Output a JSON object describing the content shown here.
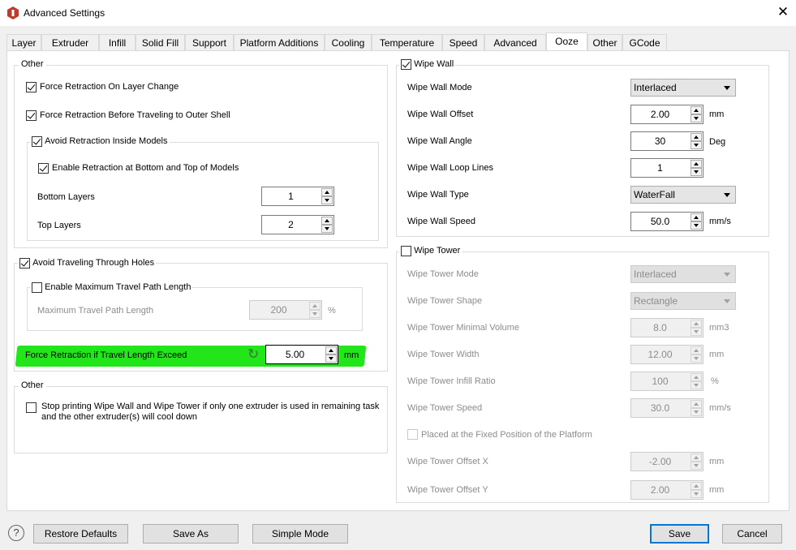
{
  "window": {
    "title": "Advanced Settings",
    "close_icon": "✕"
  },
  "tabs": [
    {
      "label": "Layer"
    },
    {
      "label": "Extruder"
    },
    {
      "label": "Infill"
    },
    {
      "label": "Solid Fill"
    },
    {
      "label": "Support"
    },
    {
      "label": "Platform Additions"
    },
    {
      "label": "Cooling"
    },
    {
      "label": "Temperature"
    },
    {
      "label": "Speed"
    },
    {
      "label": "Advanced"
    },
    {
      "label": "Ooze"
    },
    {
      "label": "Other"
    },
    {
      "label": "GCode"
    }
  ],
  "active_tab": "Ooze",
  "left": {
    "other_group": {
      "title": "Other",
      "force_retraction_layer_change": "Force Retraction On Layer Change",
      "force_retraction_outer_shell": "Force Retraction Before Traveling to Outer Shell",
      "avoid_retraction_inside": "Avoid Retraction Inside Models",
      "enable_retraction_bottom_top": "Enable Retraction at Bottom and Top of Models",
      "bottom_layers_label": "Bottom Layers",
      "bottom_layers_value": "1",
      "top_layers_label": "Top Layers",
      "top_layers_value": "2"
    },
    "avoid_travel_group": {
      "title": "Avoid Traveling Through Holes",
      "enable_max_travel": "Enable Maximum Travel Path Length",
      "max_travel_label": "Maximum Travel Path Length",
      "max_travel_value": "200",
      "max_travel_unit": "%",
      "force_retraction_exceed_label": "Force Retraction if Travel Length Exceed",
      "force_retraction_exceed_value": "5.00",
      "force_retraction_exceed_unit": "mm",
      "reset_icon": "↻"
    },
    "other_group2": {
      "title": "Other",
      "stop_printing_line1": "Stop printing Wipe Wall and Wipe Tower if only one extruder is used in remaining task",
      "stop_printing_line2": "and the other extruder(s) will cool down"
    }
  },
  "right": {
    "wipe_wall": {
      "title": "Wipe Wall",
      "mode_label": "Wipe Wall Mode",
      "mode_value": "Interlaced",
      "offset_label": "Wipe Wall Offset",
      "offset_value": "2.00",
      "offset_unit": "mm",
      "angle_label": "Wipe Wall Angle",
      "angle_value": "30",
      "angle_unit": "Deg",
      "loop_label": "Wipe Wall Loop Lines",
      "loop_value": "1",
      "type_label": "Wipe Wall Type",
      "type_value": "WaterFall",
      "speed_label": "Wipe Wall Speed",
      "speed_value": "50.0",
      "speed_unit": "mm/s"
    },
    "wipe_tower": {
      "title": "Wipe Tower",
      "mode_label": "Wipe Tower Mode",
      "mode_value": "Interlaced",
      "shape_label": "Wipe Tower Shape",
      "shape_value": "Rectangle",
      "volume_label": "Wipe Tower Minimal Volume",
      "volume_value": "8.0",
      "volume_unit": "mm3",
      "width_label": "Wipe Tower Width",
      "width_value": "12.00",
      "width_unit": "mm",
      "infill_label": "Wipe Tower Infill Ratio",
      "infill_value": "100",
      "infill_unit": "%",
      "speed_label": "Wipe Tower Speed",
      "speed_value": "30.0",
      "speed_unit": "mm/s",
      "fixed_pos_label": "Placed at the Fixed Position of the Platform",
      "offset_x_label": "Wipe Tower Offset X",
      "offset_x_value": "-2.00",
      "offset_x_unit": "mm",
      "offset_y_label": "Wipe Tower Offset Y",
      "offset_y_value": "2.00",
      "offset_y_unit": "mm"
    }
  },
  "footer": {
    "help_icon": "?",
    "restore_defaults": "Restore Defaults",
    "save_as": "Save As",
    "simple_mode": "Simple Mode",
    "save": "Save",
    "cancel": "Cancel"
  },
  "colors": {
    "highlight": "#22e51a",
    "default_button_border": "#0078d7",
    "app_icon": "#c0392b"
  }
}
